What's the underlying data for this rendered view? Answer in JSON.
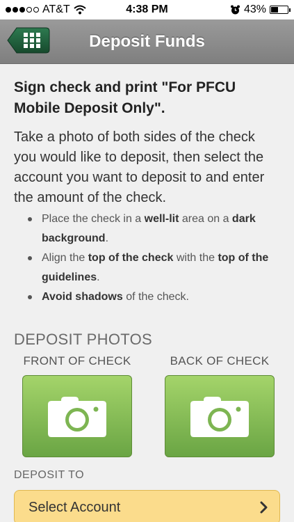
{
  "status_bar": {
    "carrier": "AT&T",
    "time": "4:38 PM",
    "battery": "43%",
    "battery_level": 0.43,
    "signal_bars": 3,
    "signal_total": 5
  },
  "nav": {
    "title": "Deposit Funds",
    "menu_icon": "grid-menu-icon"
  },
  "instructions": {
    "title": "Sign check and print \"For PFCU Mobile Deposit Only\".",
    "body": "Take a photo of both sides of the check you would like to deposit, then select the account you want to deposit to and enter the amount of the check.",
    "tips": [
      {
        "parts": [
          {
            "t": "Place the check in a ",
            "b": false
          },
          {
            "t": "well-lit",
            "b": true
          },
          {
            "t": " area on a ",
            "b": false
          },
          {
            "t": "dark background",
            "b": true
          },
          {
            "t": ".",
            "b": false
          }
        ]
      },
      {
        "parts": [
          {
            "t": "Align the ",
            "b": false
          },
          {
            "t": "top of the check",
            "b": true
          },
          {
            "t": " with the ",
            "b": false
          },
          {
            "t": "top of the guidelines",
            "b": true
          },
          {
            "t": ".",
            "b": false
          }
        ]
      },
      {
        "parts": [
          {
            "t": "Avoid shadows",
            "b": true
          },
          {
            "t": " of the check.",
            "b": false
          }
        ]
      }
    ]
  },
  "photos": {
    "section_title": "DEPOSIT PHOTOS",
    "front_label": "FRONT OF CHECK",
    "back_label": "BACK OF CHECK",
    "camera_icon": "camera-icon"
  },
  "deposit_to": {
    "label": "DEPOSIT TO",
    "select_text": "Select Account",
    "chevron_icon": "chevron-right-icon"
  },
  "colors": {
    "nav_bar": "#8a8a8a",
    "menu_button": "#1f5e3b",
    "camera_button": "#7db552",
    "select_bg": "#fbdc8c"
  }
}
